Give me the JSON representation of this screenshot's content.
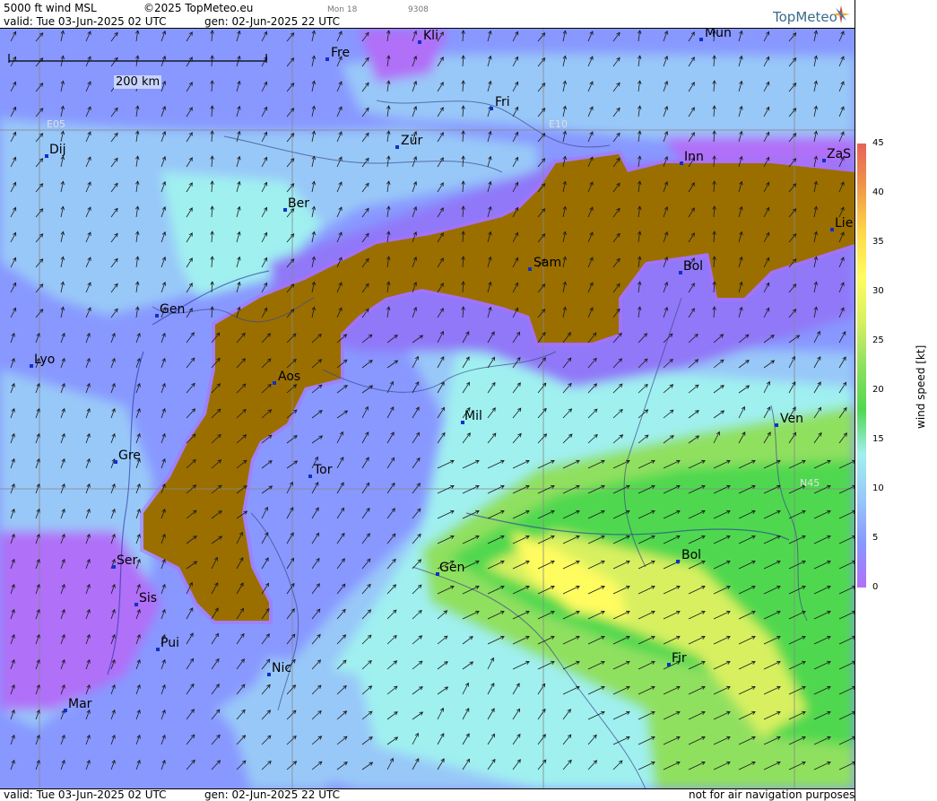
{
  "header": {
    "product": "5000 ft wind MSL",
    "copyright": "©2025 TopMeteo.eu",
    "valid": "valid:  Tue  03-Jun-2025  02 UTC",
    "gen": "gen: 02-Jun-2025 22 UTC",
    "run_code": "Mon 18",
    "code2": "9308",
    "logo": "TopMeteo"
  },
  "footer": {
    "valid": "valid:  Tue  03-Jun-2025  02 UTC",
    "gen": "gen: 02-Jun-2025 22 UTC",
    "disclaimer": "not for air navigation purposes"
  },
  "scale": {
    "label": "200 km"
  },
  "grid_labels": {
    "e05": "E05",
    "e10": "E10",
    "n45": "N45"
  },
  "legend": {
    "title": "wind speed [kt]",
    "ticks": [
      "45",
      "40",
      "35",
      "30",
      "25",
      "20",
      "15",
      "10",
      "5",
      "0"
    ],
    "colors": [
      "#e8605a",
      "#f09848",
      "#ffd84a",
      "#fffc60",
      "#d8f060",
      "#90e060",
      "#50d850",
      "#a0f0f0",
      "#98c8f8",
      "#8898ff",
      "#b070f8"
    ]
  },
  "cities": [
    {
      "name": "Kli"
    },
    {
      "name": "Mun"
    },
    {
      "name": "Fre"
    },
    {
      "name": "Fri"
    },
    {
      "name": "Dij"
    },
    {
      "name": "Zür"
    },
    {
      "name": "Inn"
    },
    {
      "name": "ZaS"
    },
    {
      "name": "Ber"
    },
    {
      "name": "Lie"
    },
    {
      "name": "Sam"
    },
    {
      "name": "Bol"
    },
    {
      "name": "Gen"
    },
    {
      "name": "Lyo"
    },
    {
      "name": "Aos"
    },
    {
      "name": "Mil"
    },
    {
      "name": "Ven"
    },
    {
      "name": "Gre"
    },
    {
      "name": "Tor"
    },
    {
      "name": "Ser"
    },
    {
      "name": "Gen"
    },
    {
      "name": "Bol"
    },
    {
      "name": "Sis"
    },
    {
      "name": "Pui"
    },
    {
      "name": "Fir"
    },
    {
      "name": "Nic"
    },
    {
      "name": "Mar"
    }
  ]
}
